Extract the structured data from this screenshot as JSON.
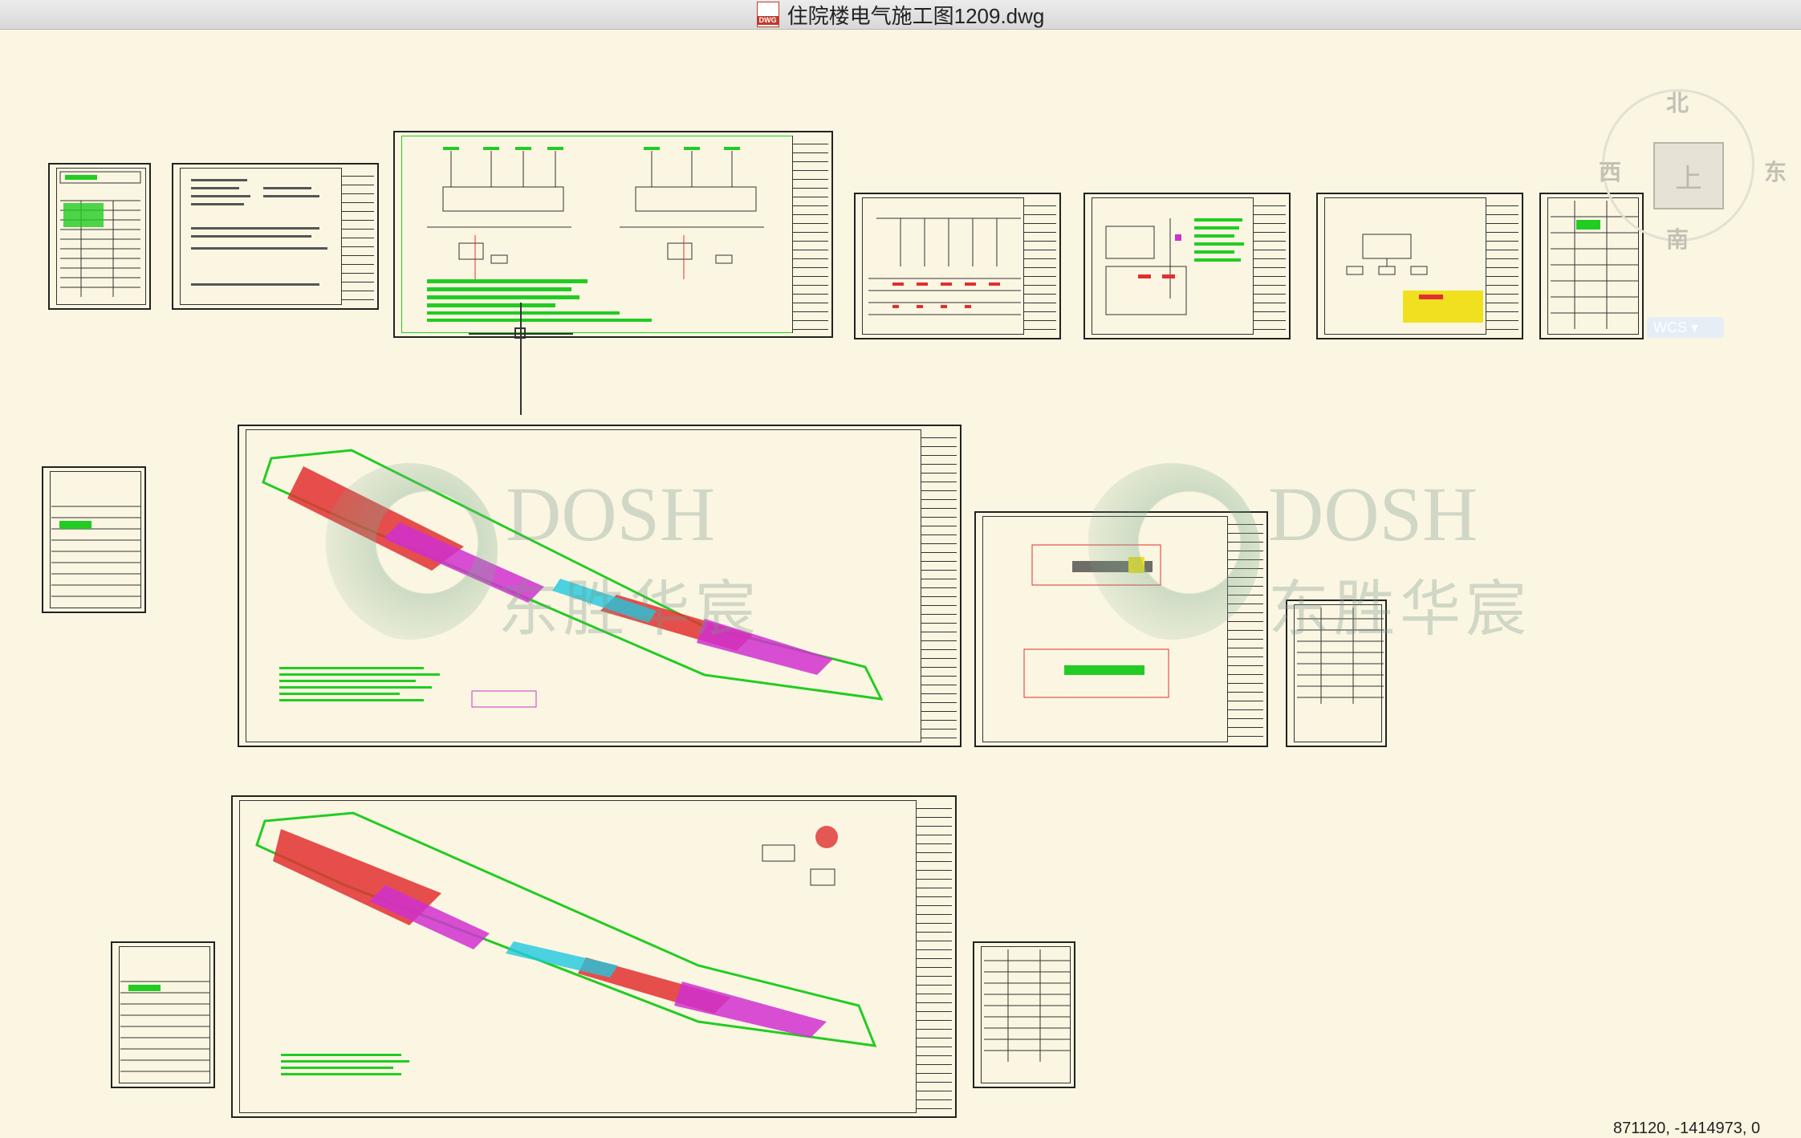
{
  "window": {
    "title": "住院楼电气施工图1209.dwg",
    "file_icon_label": "DWG"
  },
  "watermarks": [
    {
      "brand": "DOSH",
      "cn": "东胜华宸"
    },
    {
      "brand": "DOSH",
      "cn": "东胜华宸"
    }
  ],
  "viewcube": {
    "north": "北",
    "south": "南",
    "east": "东",
    "west": "西",
    "face": "上",
    "wcs": "WCS ▾"
  },
  "statusbar": {
    "coordinates": "871120, -1414973, 0"
  },
  "colors": {
    "background": "#fbf6e2",
    "lines_green": "#22cc22",
    "lines_red": "#e03030",
    "lines_magenta": "#d030d0",
    "lines_cyan": "#20c8e0",
    "lines_yellow": "#f0e020"
  }
}
